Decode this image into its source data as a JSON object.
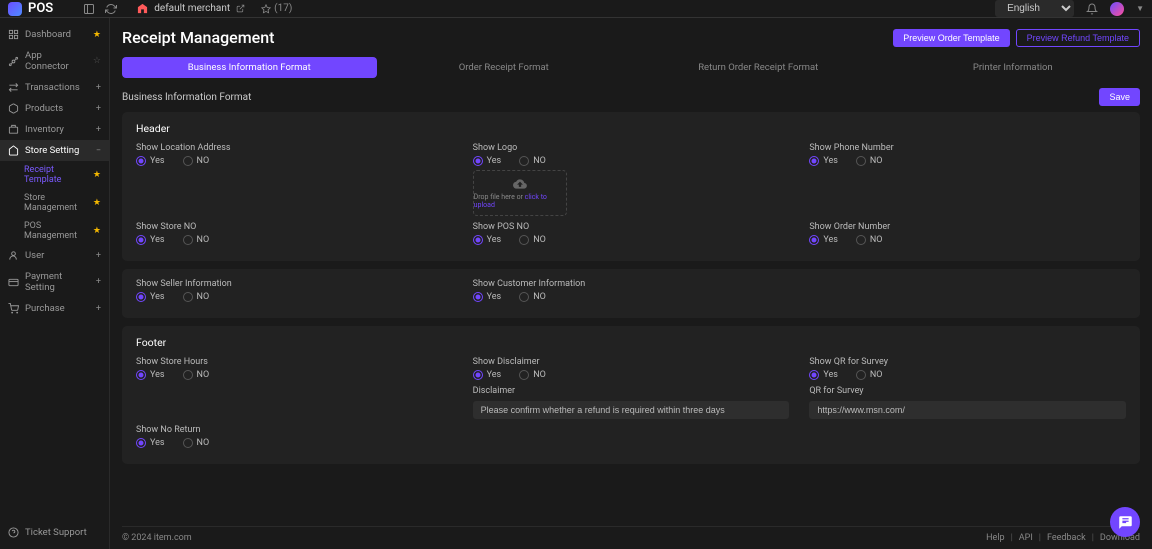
{
  "header": {
    "logo_text": "POS",
    "merchant_name": "default merchant",
    "star_count": "(17)",
    "language": "English"
  },
  "sidebar": {
    "items": [
      {
        "label": "Dashboard",
        "starred": true
      },
      {
        "label": "App Connector",
        "starred": false,
        "expandable": true
      },
      {
        "label": "Transactions",
        "expandable": true
      },
      {
        "label": "Products",
        "expandable": true
      },
      {
        "label": "Inventory",
        "expandable": true
      },
      {
        "label": "Store Setting",
        "active": true,
        "expandable": true,
        "expanded": true,
        "children": [
          {
            "label": "Receipt Template",
            "highlighted": true,
            "starred": true
          },
          {
            "label": "Store Management",
            "starred": true
          },
          {
            "label": "POS Management",
            "starred": true
          }
        ]
      },
      {
        "label": "User",
        "expandable": true
      },
      {
        "label": "Payment Setting",
        "expandable": true
      },
      {
        "label": "Purchase",
        "expandable": true
      }
    ],
    "bottom": {
      "label": "Ticket Support"
    }
  },
  "page": {
    "title": "Receipt Management",
    "preview_order": "Preview Order Template",
    "preview_refund": "Preview Refund Template",
    "tabs": [
      "Business Information Format",
      "Order Receipt Format",
      "Return Order Receipt Format",
      "Printer Information"
    ],
    "section_title": "Business Information Format",
    "save": "Save"
  },
  "labels": {
    "yes": "Yes",
    "no": "NO"
  },
  "header_card": {
    "title": "Header",
    "show_location": "Show Location Address",
    "show_logo": "Show Logo",
    "show_phone": "Show Phone Number",
    "upload_drop": "Drop file here or ",
    "upload_click": "click to upload",
    "show_store_no": "Show Store NO",
    "show_pos_no": "Show POS NO",
    "show_order_no": "Show Order Number",
    "show_seller": "Show Seller Information",
    "show_customer": "Show Customer Information"
  },
  "footer_card": {
    "title": "Footer",
    "show_store_hours": "Show Store Hours",
    "show_disclaimer": "Show Disclaimer",
    "show_qr": "Show QR for Survey",
    "disclaimer_label": "Disclaimer",
    "disclaimer_value": "Please confirm whether a refund is required within three days",
    "qr_label": "QR for Survey",
    "qr_value": "https://www.msn.com/",
    "show_no_return": "Show No Return"
  },
  "footer": {
    "copyright": "© 2024 item.com",
    "links": [
      "Help",
      "API",
      "Feedback",
      "Download"
    ]
  }
}
